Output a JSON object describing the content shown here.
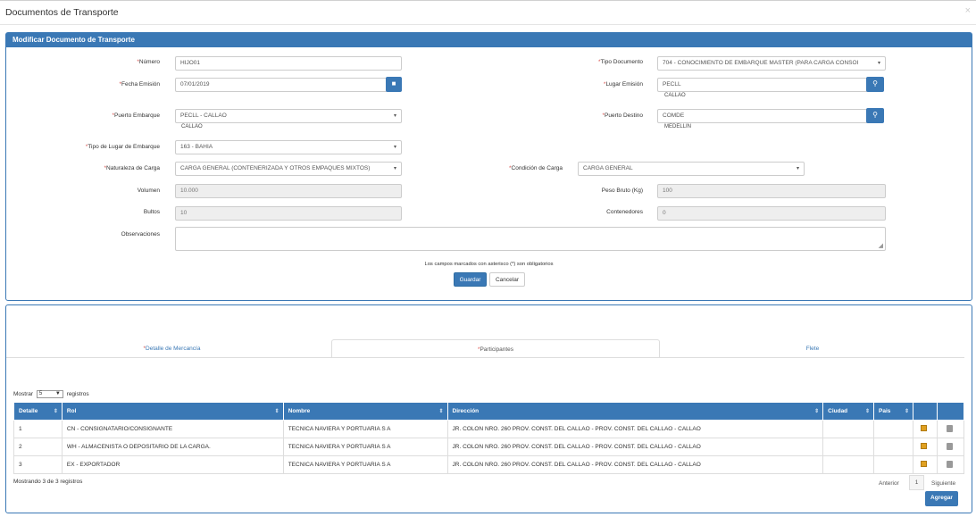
{
  "modal": {
    "title": "Documentos de Transporte",
    "close": "×"
  },
  "panel": {
    "title": "Modificar Documento de Transporte"
  },
  "form": {
    "numero": {
      "label": "Número",
      "value": "HIJO01"
    },
    "tipo_documento": {
      "label": "Tipo Documento",
      "value": "704 - CONOCIMIENTO DE EMBARQUE MASTER (PARA CARGA CONSOI"
    },
    "fecha_emision": {
      "label": "Fecha Emisión",
      "value": "07/01/2019"
    },
    "lugar_emision": {
      "label": "Lugar Emisión",
      "value": "PECLL",
      "sub": "CALLAO"
    },
    "puerto_embarque": {
      "label": "Puerto Embarque",
      "value": "PECLL - CALLAO",
      "sub": "CALLAO"
    },
    "puerto_destino": {
      "label": "Puerto Destino",
      "value": "COMDE",
      "sub": "MEDELLIN"
    },
    "tipo_lugar_embarque": {
      "label": "Tipo de Lugar de Embarque",
      "value": "163 - BAHIA"
    },
    "naturaleza_carga": {
      "label": "Naturaleza de Carga",
      "value": "CARGA GENERAL (CONTENERIZADA Y OTROS EMPAQUES MIXTOS)"
    },
    "condicion_carga": {
      "label": "Condición de Carga",
      "value": "CARGA GENERAL"
    },
    "volumen": {
      "label": "Volumen",
      "value": "10.000"
    },
    "peso_bruto": {
      "label": "Peso Bruto (Kg)",
      "value": "100"
    },
    "bultos": {
      "label": "Bultos",
      "value": "10"
    },
    "contenedores": {
      "label": "Contenedores",
      "value": "0"
    },
    "observaciones": {
      "label": "Observaciones",
      "value": ""
    },
    "required_mark": "*",
    "note": "Los campos marcados con asterisco (*) son obligatorios",
    "save_label": "Guardar",
    "cancel_label": "Cancelar"
  },
  "tabs": [
    {
      "label": "Detalle de Mercancía",
      "required": true
    },
    {
      "label": "Participantes",
      "required": true
    },
    {
      "label": "Flete",
      "required": false
    }
  ],
  "table": {
    "length_prefix": "Mostrar",
    "length_value": "5",
    "length_suffix": "registros",
    "columns": [
      "Detalle",
      "Rol",
      "Nombre",
      "Dirección",
      "Ciudad",
      "Pais",
      "",
      ""
    ],
    "rows": [
      [
        "1",
        "CN - CONSIGNATARIO/CONSIGNANTE",
        "TECNICA NAVIERA Y PORTUARIA S A",
        "JR. COLON NRO. 260 PROV. CONST. DEL CALLAO - PROV. CONST. DEL CALLAO - CALLAO",
        "",
        ""
      ],
      [
        "2",
        "WH - ALMACENISTA O DEPOSITARIO DE LA CARGA.",
        "TECNICA NAVIERA Y PORTUARIA S A",
        "JR. COLON NRO. 260 PROV. CONST. DEL CALLAO - PROV. CONST. DEL CALLAO - CALLAO",
        "",
        ""
      ],
      [
        "3",
        "EX - EXPORTADOR",
        "TECNICA NAVIERA Y PORTUARIA S A",
        "JR. COLON NRO. 260 PROV. CONST. DEL CALLAO - PROV. CONST. DEL CALLAO - CALLAO",
        "",
        ""
      ]
    ],
    "info": "Mostrando 3 de 3 registros",
    "prev_label": "Anterior",
    "page": "1",
    "next_label": "Siguiente",
    "add_label": "Agregar"
  },
  "colors": {
    "primary": "#3a78b5",
    "required": "#d9534f"
  }
}
